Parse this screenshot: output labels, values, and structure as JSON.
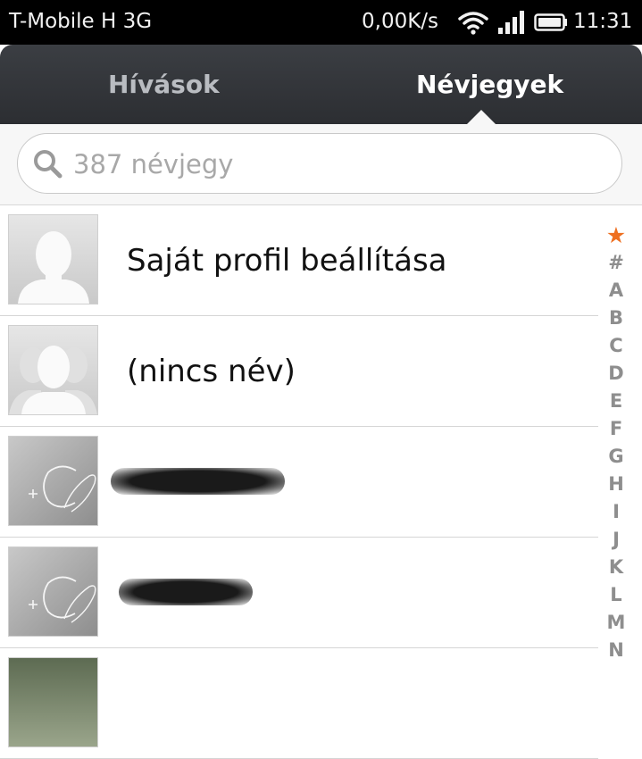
{
  "status_bar": {
    "carrier": "T-Mobile H 3G",
    "speed": "0,00K/s",
    "time": "11:31",
    "icons": [
      "wifi-icon",
      "signal-icon",
      "battery-icon"
    ]
  },
  "tabs": [
    {
      "label": "Hívások",
      "active": false
    },
    {
      "label": "Névjegyek",
      "active": true
    }
  ],
  "search": {
    "placeholder": "387 névjegy",
    "value": ""
  },
  "contacts": [
    {
      "label": "Saját profil beállítása",
      "avatar": "single-person-avatar"
    },
    {
      "label": "(nincs név)",
      "avatar": "group-avatar"
    },
    {
      "label": "",
      "avatar": "add-contact-avatar",
      "redacted": true
    },
    {
      "label": "",
      "avatar": "add-contact-avatar",
      "redacted": true
    },
    {
      "label": "",
      "avatar": "photo-avatar"
    }
  ],
  "index_letters": [
    "★",
    "#",
    "A",
    "B",
    "C",
    "D",
    "E",
    "F",
    "G",
    "H",
    "I",
    "J",
    "K",
    "L",
    "M",
    "N"
  ],
  "colors": {
    "accent": "#ee6f20",
    "tab_bar": "#2c2e32",
    "index_text": "#8e8e8e"
  }
}
